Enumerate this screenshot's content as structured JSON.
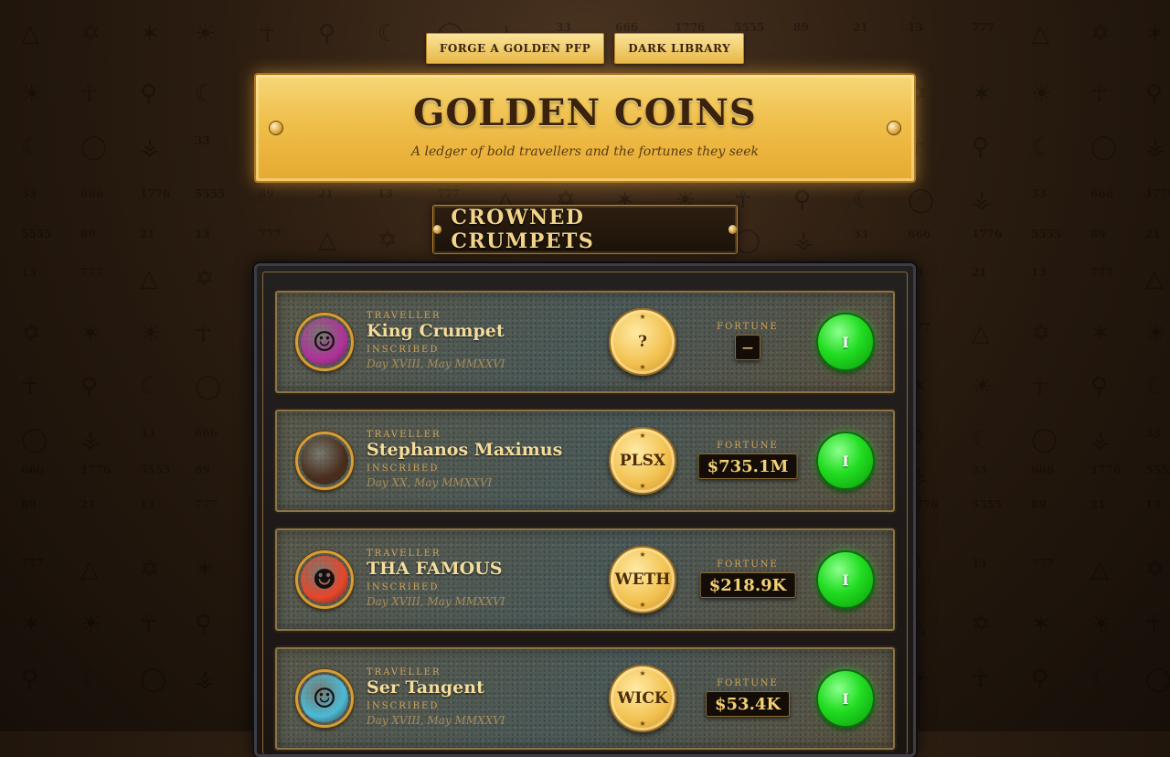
{
  "nav": {
    "forge_label": "FORGE A GOLDEN PFP",
    "library_label": "DARK LIBRARY"
  },
  "banner": {
    "title": "GOLDEN COINS",
    "subtitle": "A ledger of bold travellers and the fortunes they seek"
  },
  "section": {
    "title": "CROWNED CRUMPETS"
  },
  "labels": {
    "traveller": "TRAVELLER",
    "inscribed": "INSCRIBED",
    "fortune": "FORTUNE"
  },
  "rows": [
    {
      "name": "King Crumpet",
      "date": "Day XVIII, May MMXXVI",
      "coin": "?",
      "fortune": "—",
      "action": "I",
      "avatar_color": "#b0309a"
    },
    {
      "name": "Stephanos Maximus",
      "date": "Day XX, May MMXXVI",
      "coin": "PLSX",
      "fortune": "$735.1M",
      "action": "I",
      "avatar_color": "#4a2c1a"
    },
    {
      "name": "THA FAMOUS",
      "date": "Day XVIII, May MMXXVI",
      "coin": "WETH",
      "fortune": "$218.9K",
      "action": "I",
      "avatar_color": "#e8452a"
    },
    {
      "name": "Ser Tangent",
      "date": "Day XVIII, May MMXXVI",
      "coin": "WICK",
      "fortune": "$53.4K",
      "action": "I",
      "avatar_color": "#4bbad6"
    }
  ],
  "colors": {
    "gold": "#f0c14e",
    "action_green": "#22dd22",
    "background": "#2a1c10"
  },
  "icons": {
    "background_pattern": "occult-symbols-pattern",
    "action": "green-gem-button"
  }
}
